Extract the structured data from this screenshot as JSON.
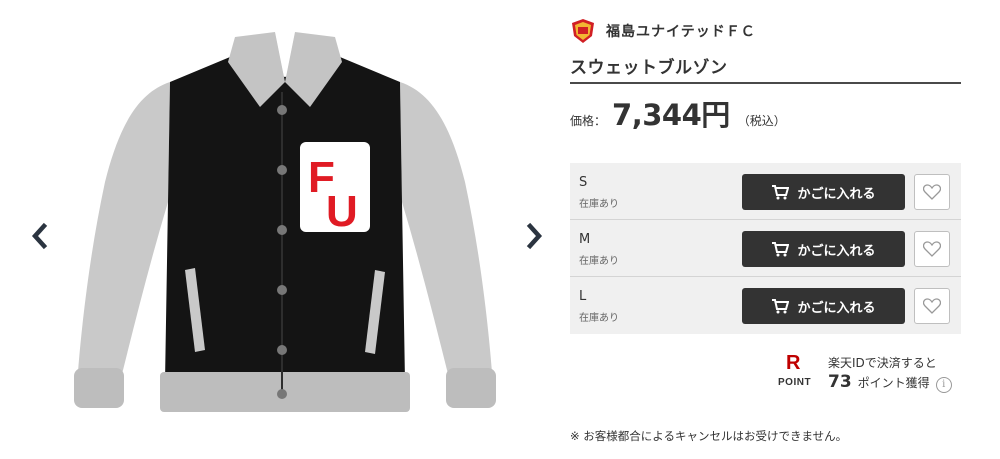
{
  "shop": {
    "name": "福島ユナイテッドＦＣ",
    "logo_icon": "club-crest-icon"
  },
  "product": {
    "title": "スウェットブルゾン"
  },
  "price": {
    "label": "価格：",
    "value": "7,344円",
    "tax_note": "（税込）"
  },
  "variants": [
    {
      "size": "S",
      "stock": "在庫あり",
      "cart_label": "かごに入れる"
    },
    {
      "size": "M",
      "stock": "在庫あり",
      "cart_label": "かごに入れる"
    },
    {
      "size": "L",
      "stock": "在庫あり",
      "cart_label": "かごに入れる"
    }
  ],
  "points": {
    "logo_letter": "R",
    "logo_word": "POINT",
    "line1": "楽天IDで決済すると",
    "number": "73",
    "line2": "ポイント獲得",
    "info": "i"
  },
  "notice": "※ お客様都合によるキャンセルはお受けできません。",
  "colors": {
    "button_bg": "#333333",
    "variant_bg": "#f0f0f0",
    "point_red": "#bf0000",
    "patch_red": "#e01b24"
  },
  "icons": {
    "prev": "chevron-left-icon",
    "next": "chevron-right-icon",
    "cart": "cart-icon",
    "favorite": "heart-icon"
  }
}
